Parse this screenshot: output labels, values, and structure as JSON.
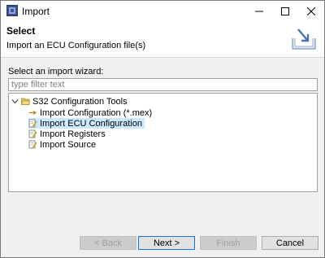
{
  "window": {
    "title": "Import"
  },
  "banner": {
    "title": "Select",
    "description": "Import an ECU Configuration file(s)"
  },
  "wizard": {
    "prompt": "Select an import wizard:",
    "filter_placeholder": "type filter text",
    "filter_value": ""
  },
  "tree": {
    "root": {
      "label": "S32 Configuration Tools",
      "expanded": true,
      "icon": "folder-open-icon"
    },
    "children": [
      {
        "label": "Import Configuration (*.mex)",
        "icon": "arrow-import-icon",
        "selected": false
      },
      {
        "label": "Import ECU Configuration",
        "icon": "document-pencil-icon",
        "selected": true
      },
      {
        "label": "Import Registers",
        "icon": "document-pencil-icon",
        "selected": false
      },
      {
        "label": "Import Source",
        "icon": "document-pencil-icon",
        "selected": false
      }
    ]
  },
  "buttons": {
    "back": "< Back",
    "next": "Next >",
    "finish": "Finish",
    "cancel": "Cancel"
  },
  "colors": {
    "selection": "#cce8ff",
    "default_button_border": "#0078d7",
    "folder": "#e8c060"
  }
}
